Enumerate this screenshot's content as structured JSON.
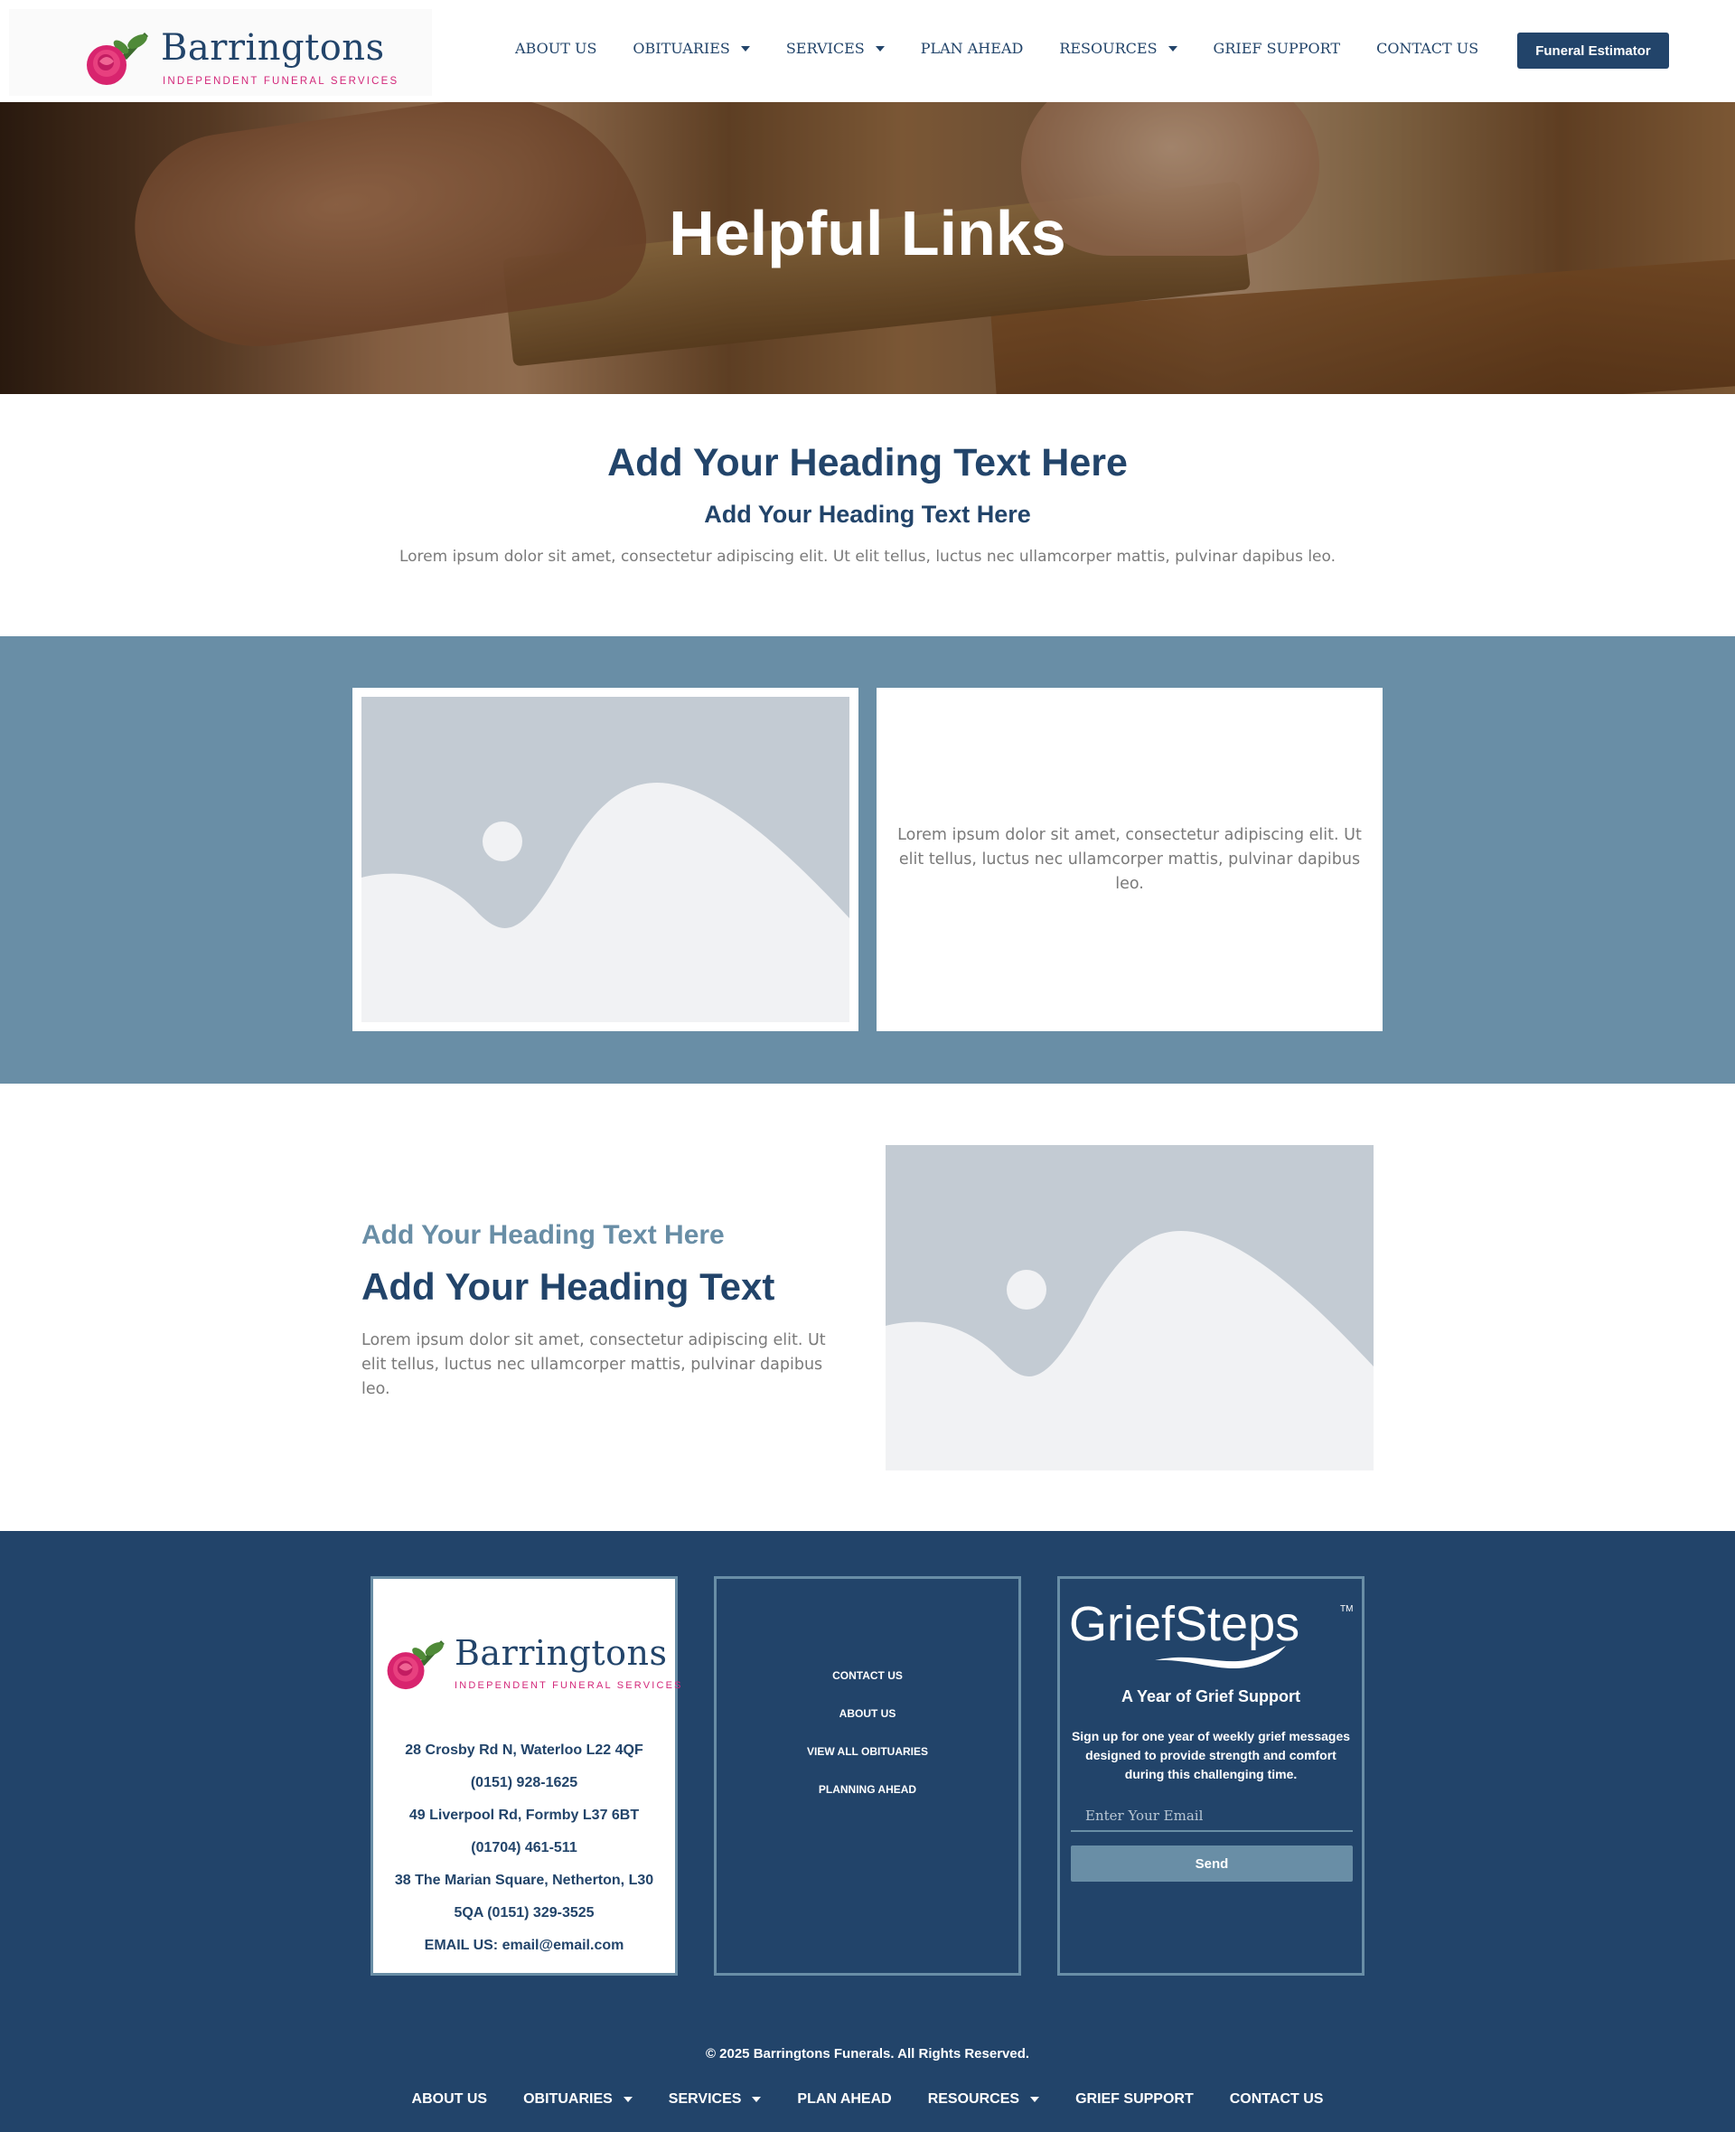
{
  "header": {
    "logo": {
      "name": "Barringtons",
      "tagline": "INDEPENDENT FUNERAL SERVICES"
    },
    "nav": [
      {
        "label": "ABOUT US",
        "dropdown": false
      },
      {
        "label": "OBITUARIES",
        "dropdown": true
      },
      {
        "label": "SERVICES",
        "dropdown": true
      },
      {
        "label": "PLAN AHEAD",
        "dropdown": false
      },
      {
        "label": "RESOURCES",
        "dropdown": true
      },
      {
        "label": "GRIEF SUPPORT",
        "dropdown": false
      },
      {
        "label": "CONTACT US",
        "dropdown": false
      }
    ],
    "cta_label": "Funeral Estimator"
  },
  "hero": {
    "title": "Helpful Links"
  },
  "intro": {
    "heading": "Add Your Heading Text Here",
    "subheading": "Add Your Heading Text Here",
    "body": "Lorem ipsum dolor sit amet, consectetur adipiscing elit. Ut elit tellus, luctus nec ullamcorper mattis, pulvinar dapibus leo."
  },
  "band": {
    "card_text": "Lorem ipsum dolor sit amet, consectetur adipiscing elit. Ut elit tellus, luctus nec ullamcorper mattis, pulvinar dapibus leo."
  },
  "feature": {
    "subheading": "Add Your Heading Text Here",
    "heading": "Add Your Heading Text",
    "body": "Lorem ipsum dolor sit amet, consectetur adipiscing elit. Ut elit tellus, luctus nec ullamcorper mattis, pulvinar dapibus leo."
  },
  "footer": {
    "logo": {
      "name": "Barringtons",
      "tagline": "INDEPENDENT FUNERAL SERVICES"
    },
    "address_lines": [
      "28 Crosby Rd N, Waterloo L22 4QF",
      "(0151) 928-1625",
      "49 Liverpool Rd, Formby L37 6BT",
      "(01704) 461-511",
      "38 The Marian Square, Netherton, L30",
      "5QA (0151) 329-3525",
      "EMAIL US: email@email.com"
    ],
    "links": [
      "CONTACT US",
      "ABOUT US",
      "VIEW ALL OBITUARIES",
      "PLANNING AHEAD"
    ],
    "griefsteps": {
      "brand": "GriefSteps",
      "trademark": "TM",
      "title": "A Year of Grief Support",
      "description": "Sign up for one year of weekly grief messages designed to provide strength and comfort during this challenging time.",
      "email_placeholder": "Enter Your Email",
      "send_label": "Send"
    },
    "copyright": "© 2025 Barringtons Funerals. All Rights Reserved.",
    "nav": [
      {
        "label": "ABOUT US",
        "dropdown": false
      },
      {
        "label": "OBITUARIES",
        "dropdown": true
      },
      {
        "label": "SERVICES",
        "dropdown": true
      },
      {
        "label": "PLAN AHEAD",
        "dropdown": false
      },
      {
        "label": "RESOURCES",
        "dropdown": true
      },
      {
        "label": "GRIEF SUPPORT",
        "dropdown": false
      },
      {
        "label": "CONTACT US",
        "dropdown": false
      }
    ]
  },
  "colors": {
    "navy": "#22446a",
    "steel_blue": "#698ea6",
    "pink_accent": "#d3287a",
    "body_gray": "#7a7a7a"
  }
}
